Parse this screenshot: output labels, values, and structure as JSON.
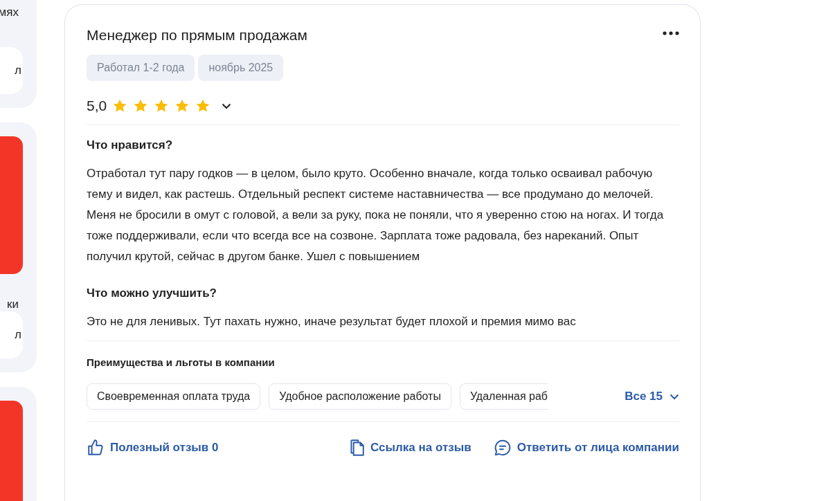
{
  "sidebar": {
    "fragments": [
      {
        "kind": "text",
        "text": "мях"
      },
      {
        "kind": "card",
        "text": "л"
      },
      {
        "kind": "promo"
      },
      {
        "kind": "text",
        "text": "ки"
      },
      {
        "kind": "card",
        "text": "л"
      },
      {
        "kind": "promo"
      }
    ]
  },
  "review": {
    "title": "Менеджер по прямым продажам",
    "tags": [
      "Работал 1-2 года",
      "ноябрь 2025"
    ],
    "rating": "5,0",
    "stars": 5,
    "sections": [
      {
        "heading": "Что нравится?",
        "text": "Отработал тут пару годков — в целом, было круто. Особенно вначале, когда только осваивал рабочую тему и видел, как растешь. Отдельный респект системе наставничества — все продумано до мелочей. Меня не бросили в омут с головой, а вели за руку, пока не поняли, что я уверенно стою на ногах. И тогда тоже поддерживали, если что всегда все на созвоне. Зарплата тоже радовала, без нареканий. Опыт получил крутой, сейчас в другом банке. Ушел с повышением"
      },
      {
        "heading": "Что можно улучшить?",
        "text": "Это не для ленивых. Тут пахать нужно, иначе результат будет плохой и премия мимо вас"
      }
    ],
    "benefits": {
      "heading": "Преимущества и льготы в компании",
      "items": [
        "Своевременная оплата труда",
        "Удобное расположение работы",
        "Удаленная раб"
      ],
      "more": "Все 15"
    },
    "actions": [
      {
        "kind": "like",
        "label": "Полезный отзыв 0"
      },
      {
        "kind": "copy",
        "label": "Ссылка на отзыв"
      },
      {
        "kind": "reply",
        "label": "Ответить от лица компании"
      }
    ]
  }
}
